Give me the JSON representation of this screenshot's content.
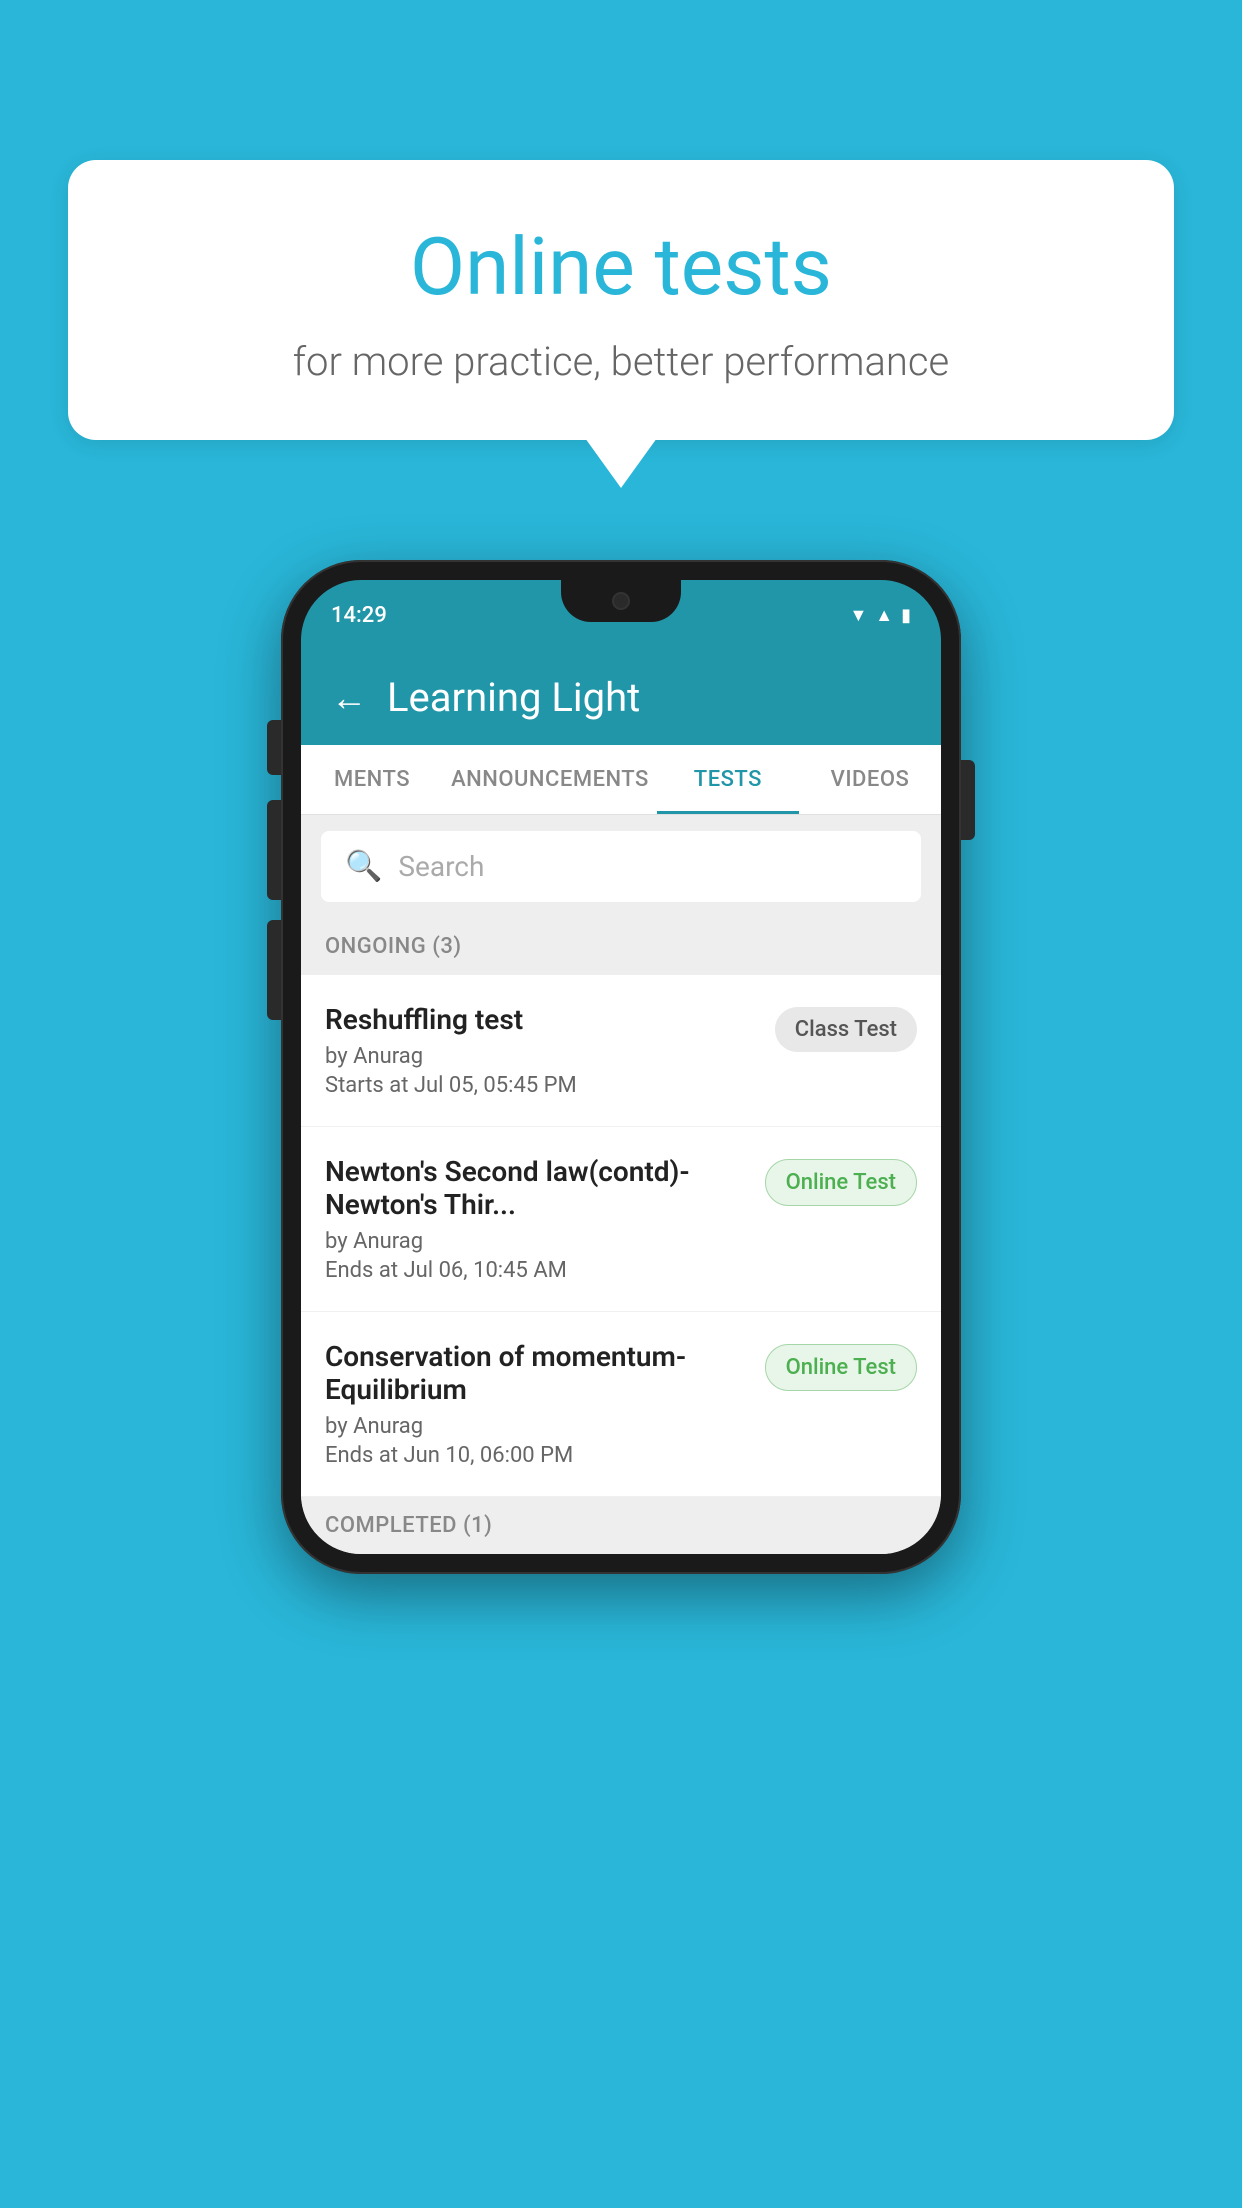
{
  "background_color": "#29b6d8",
  "speech_bubble": {
    "title": "Online tests",
    "subtitle": "for more practice, better performance"
  },
  "phone": {
    "status_bar": {
      "time": "14:29",
      "icons": [
        "wifi",
        "signal",
        "battery"
      ]
    },
    "app_bar": {
      "title": "Learning Light",
      "back_label": "←"
    },
    "tabs": [
      {
        "label": "MENTS",
        "active": false
      },
      {
        "label": "ANNOUNCEMENTS",
        "active": false
      },
      {
        "label": "TESTS",
        "active": true
      },
      {
        "label": "VIDEOS",
        "active": false
      }
    ],
    "search": {
      "placeholder": "Search"
    },
    "sections": [
      {
        "header": "ONGOING (3)",
        "items": [
          {
            "title": "Reshuffling test",
            "by": "by Anurag",
            "time": "Starts at  Jul 05, 05:45 PM",
            "badge": "Class Test",
            "badge_type": "class"
          },
          {
            "title": "Newton's Second law(contd)-Newton's Thir...",
            "by": "by Anurag",
            "time": "Ends at  Jul 06, 10:45 AM",
            "badge": "Online Test",
            "badge_type": "online"
          },
          {
            "title": "Conservation of momentum-Equilibrium",
            "by": "by Anurag",
            "time": "Ends at  Jun 10, 06:00 PM",
            "badge": "Online Test",
            "badge_type": "online"
          }
        ]
      }
    ],
    "completed_header": "COMPLETED (1)"
  }
}
